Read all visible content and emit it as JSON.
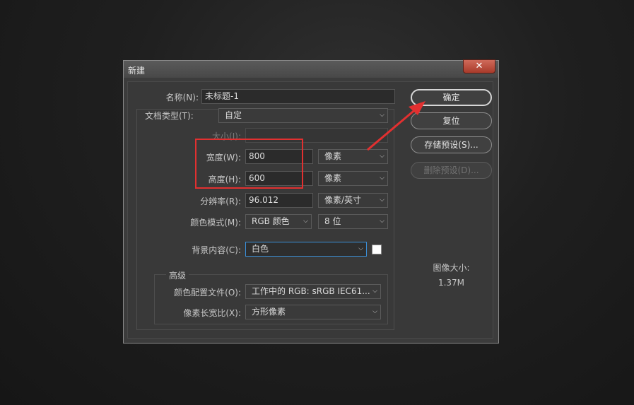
{
  "dialog": {
    "title": "新建",
    "close_icon": "close-icon",
    "name_label": "名称(N):",
    "name_value": "未标题-1",
    "doctype_label": "文档类型(T):",
    "doctype_value": "自定",
    "size_label": "大小(I):",
    "width_label": "宽度(W):",
    "width_value": "800",
    "width_unit": "像素",
    "height_label": "高度(H):",
    "height_value": "600",
    "height_unit": "像素",
    "resolution_label": "分辨率(R):",
    "resolution_value": "96.012",
    "resolution_unit": "像素/英寸",
    "colormode_label": "颜色模式(M):",
    "colormode_value": "RGB 颜色",
    "bitdepth_value": "8 位",
    "background_label": "背景内容(C):",
    "background_value": "白色",
    "background_swatch_color": "#ffffff",
    "advanced_label": "高级",
    "profile_label": "颜色配置文件(O):",
    "profile_value": "工作中的 RGB: sRGB IEC61...",
    "aspect_label": "像素长宽比(X):",
    "aspect_value": "方形像素",
    "ok_button": "确定",
    "reset_button": "复位",
    "save_preset_button": "存储预设(S)...",
    "delete_preset_button": "删除预设(D)...",
    "image_size_label": "图像大小:",
    "image_size_value": "1.37M",
    "annotation_color": "#e23030"
  }
}
